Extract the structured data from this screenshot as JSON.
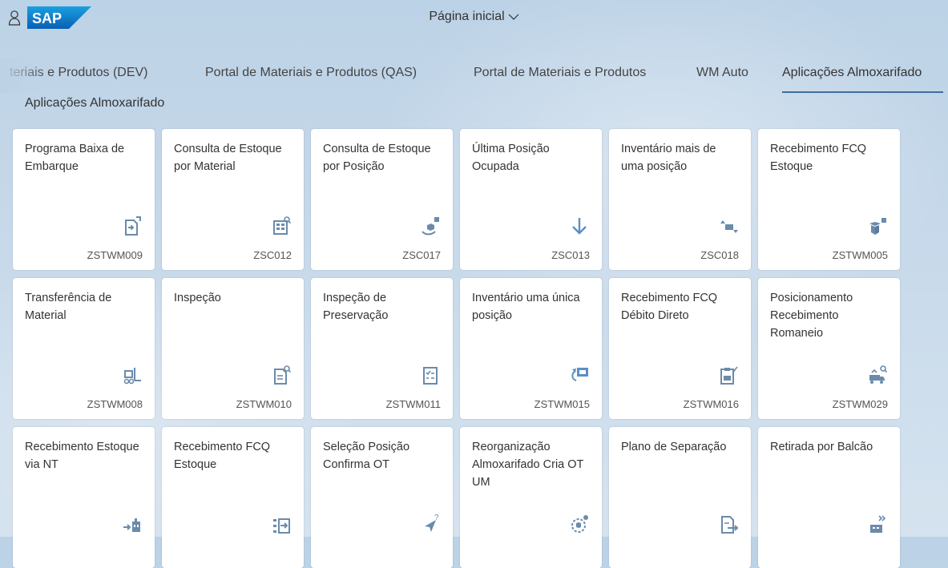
{
  "shell": {
    "title": "Página inicial",
    "logo_text": "SAP"
  },
  "tabs": [
    {
      "label": "teriais e Produtos (DEV)"
    },
    {
      "label": "Portal de Materiais e Produtos (QAS)"
    },
    {
      "label": "Portal de Materiais e Produtos"
    },
    {
      "label": "WM Auto"
    },
    {
      "label": "Aplicações Almoxarifado"
    }
  ],
  "group": {
    "title": "Aplicações Almoxarifado"
  },
  "tiles": [
    {
      "title": "Programa Baixa de Embarque",
      "code": "ZSTWM009",
      "icon": "document-arrow-icon"
    },
    {
      "title": "Consulta de Estoque por Material",
      "code": "ZSC012",
      "icon": "table-search-icon"
    },
    {
      "title": "Consulta de Estoque por Posição",
      "code": "ZSC017",
      "icon": "box-location-icon"
    },
    {
      "title": "Última Posição Ocupada",
      "code": "ZSC013",
      "icon": "arrow-down-icon"
    },
    {
      "title": "Inventário mais de uma posição",
      "code": "ZSC018",
      "icon": "transfer-arrows-icon"
    },
    {
      "title": "Recebimento FCQ Estoque",
      "code": "ZSTWM005",
      "icon": "open-box-icon"
    },
    {
      "title": "Transferência de Material",
      "code": "ZSTWM008",
      "icon": "forklift-icon"
    },
    {
      "title": "Inspeção",
      "code": "ZSTWM010",
      "icon": "document-inspect-icon"
    },
    {
      "title": "Inspeção de Preservação",
      "code": "ZSTWM011",
      "icon": "checklist-icon"
    },
    {
      "title": "Inventário uma única posição",
      "code": "ZSTWM015",
      "icon": "monitor-arrow-icon"
    },
    {
      "title": "Recebimento FCQ Débito Direto",
      "code": "ZSTWM016",
      "icon": "clipboard-check-icon"
    },
    {
      "title": "Posicionamento Recebimento Romaneio",
      "code": "ZSTWM029",
      "icon": "truck-search-icon"
    },
    {
      "title": "Recebimento Estoque via NT",
      "code": "",
      "icon": "warehouse-arrow-icon"
    },
    {
      "title": "Recebimento FCQ Estoque",
      "code": "",
      "icon": "list-arrow-icon"
    },
    {
      "title": "Seleção Posição Confirma OT",
      "code": "",
      "icon": "location-question-icon"
    },
    {
      "title": "Reorganização Almoxarifado Cria OT UM",
      "code": "",
      "icon": "boxes-icon"
    },
    {
      "title": "Plano de Separação",
      "code": "",
      "icon": "document-export-icon"
    },
    {
      "title": "Retirada por Balcão",
      "code": "",
      "icon": "counter-forward-icon"
    }
  ]
}
